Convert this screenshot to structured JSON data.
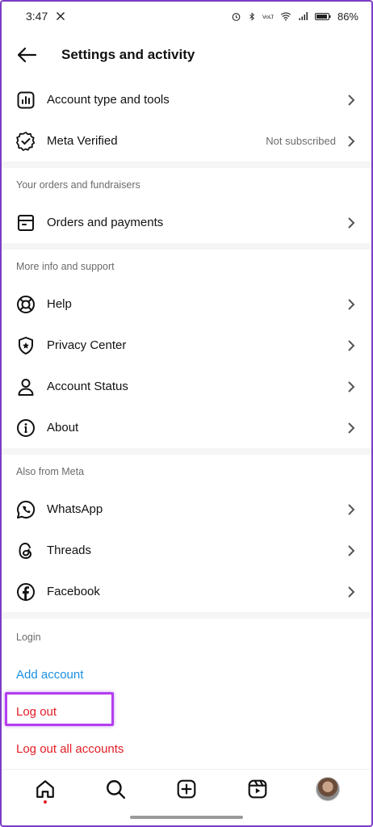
{
  "status": {
    "time": "3:47",
    "battery": "86%"
  },
  "header": {
    "title": "Settings and activity"
  },
  "group1": [
    {
      "label": "Account type and tools",
      "value": ""
    },
    {
      "label": "Meta Verified",
      "value": "Not subscribed"
    }
  ],
  "orders": {
    "heading": "Your orders and fundraisers",
    "items": [
      {
        "label": "Orders and payments"
      }
    ]
  },
  "support": {
    "heading": "More info and support",
    "items": [
      {
        "label": "Help"
      },
      {
        "label": "Privacy Center"
      },
      {
        "label": "Account Status"
      },
      {
        "label": "About"
      }
    ]
  },
  "meta": {
    "heading": "Also from Meta",
    "items": [
      {
        "label": "WhatsApp"
      },
      {
        "label": "Threads"
      },
      {
        "label": "Facebook"
      }
    ]
  },
  "login": {
    "heading": "Login",
    "add": "Add account",
    "logout": "Log out",
    "logout_all": "Log out all accounts"
  },
  "colors": {
    "link": "#1a8fe3",
    "danger": "#e11d25",
    "highlight": "#b43ef0"
  }
}
